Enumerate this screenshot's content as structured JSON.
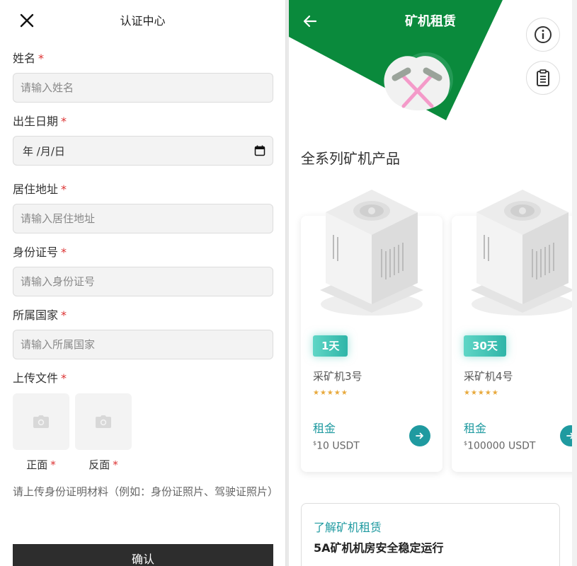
{
  "left": {
    "title": "认证中心",
    "fields": [
      {
        "label": "姓名",
        "placeholder": "请输入姓名"
      },
      {
        "label": "出生日期",
        "value": "年 /月/日"
      },
      {
        "label": "居住地址",
        "placeholder": "请输入居住地址"
      },
      {
        "label": "身份证号",
        "placeholder": "请输入身份证号"
      },
      {
        "label": "所属国家",
        "placeholder": "请输入所属国家"
      }
    ],
    "required_mark": "*",
    "upload": {
      "label": "上传文件",
      "front": "正面",
      "back": "反面",
      "hint": "请上传身份证明材料（例如：身份证照片、驾驶证照片）"
    },
    "confirm": "确认"
  },
  "right": {
    "title": "矿机租赁",
    "brand_green": "#0a8a3c",
    "section_title": "全系列矿机产品",
    "products": [
      {
        "tag": "1天",
        "name": "采矿机3号",
        "rating": 5,
        "rent_label": "租金",
        "currency": "$",
        "price": "10 USDT"
      },
      {
        "tag": "30天",
        "name": "采矿机4号",
        "rating": 5,
        "rent_label": "租金",
        "currency": "$",
        "price": "100000 USDT"
      }
    ],
    "info": {
      "link": "了解矿机租赁",
      "subtitle": "5A矿机机房安全稳定运行"
    }
  }
}
